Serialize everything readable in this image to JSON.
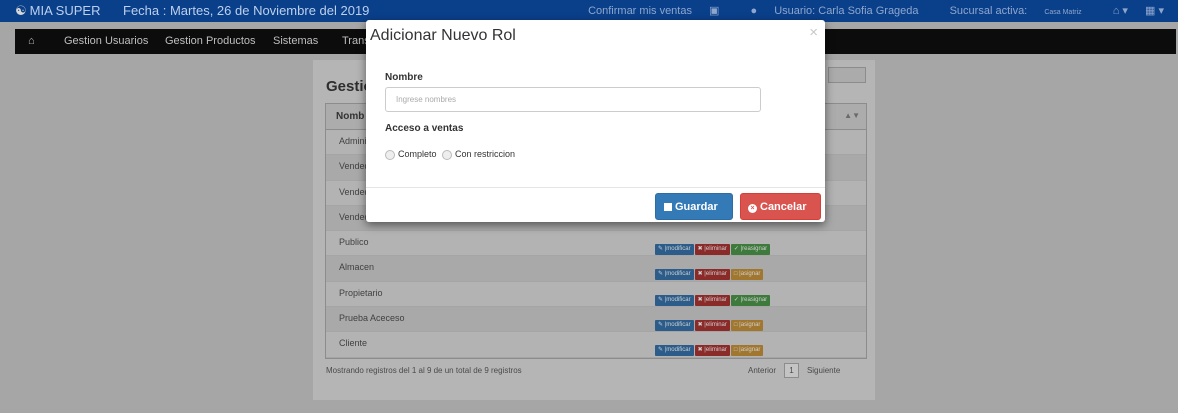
{
  "header": {
    "brand": "MIA SUPER",
    "fecha": "Fecha : Martes, 26 de Noviembre del 2019",
    "confirm_sales": "Confirmar mis ventas",
    "user": "Usuario: Carla Sofia Grageda",
    "branch_label": "Sucursal activa:",
    "branch_value": "Casa Matriz"
  },
  "nav": {
    "items": [
      "Gestion Usuarios",
      "Gestion Productos",
      "Sistemas",
      "Trans"
    ]
  },
  "page": {
    "title": "Gestion",
    "table_header": "Nomb",
    "rows": [
      {
        "name": "Admini"
      },
      {
        "name": "Vended"
      },
      {
        "name": "Vended"
      },
      {
        "name": "Vended"
      },
      {
        "name": "Publico",
        "actions": [
          "modificar",
          "eliminar",
          "reasignar"
        ]
      },
      {
        "name": "Almacen",
        "actions": [
          "modificar",
          "eliminar",
          "asignar"
        ]
      },
      {
        "name": "Propietario",
        "actions": [
          "modificar",
          "eliminar",
          "reasignar"
        ]
      },
      {
        "name": "Prueba Aceceso",
        "actions": [
          "modificar",
          "eliminar",
          "asignar"
        ]
      },
      {
        "name": "Cliente",
        "actions": [
          "modificar",
          "eliminar",
          "asignar"
        ]
      }
    ],
    "footer_text": "Mostrando registros del 1 al 9 de un total de 9 registros",
    "pagination": {
      "prev": "Anterior",
      "page": "1",
      "next": "Siguiente"
    }
  },
  "modal": {
    "title": "Adicionar Nuevo Rol",
    "close": "×",
    "name_label": "Nombre",
    "name_placeholder": "Ingrese nombres",
    "access_label": "Acceso a ventas",
    "option_complete": "Completo",
    "option_restricted": "Con restriccion",
    "save_label": "Guardar",
    "cancel_label": "Cancelar"
  },
  "colors": {
    "header_bg": "#0a3f8a",
    "save_button": "#337ab7",
    "cancel_button": "#d9534f"
  }
}
